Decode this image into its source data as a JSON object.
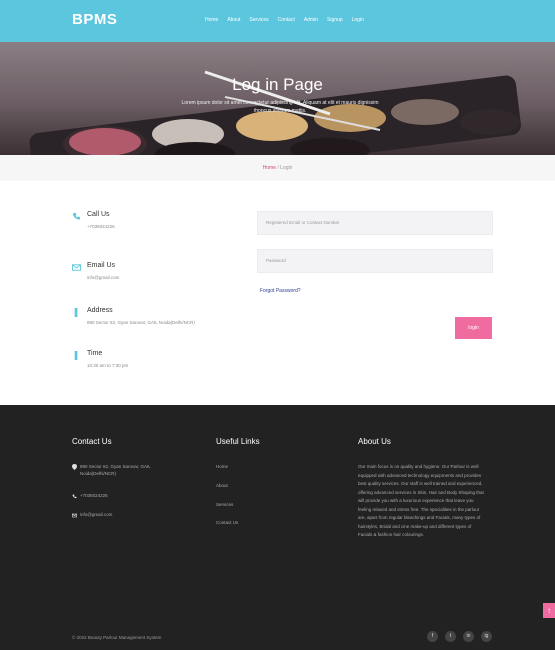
{
  "header": {
    "brand": "BPMS",
    "nav": [
      "Home",
      "About",
      "Services",
      "Contact",
      "Admin",
      "Signup",
      "Login"
    ]
  },
  "hero": {
    "title": "Log in Page",
    "subtitle": "Lorem ipsum dolor sit amet consectetur adipiscing elit. Aliquam at elit et mauris dignissim rhoncus aliquam mattis."
  },
  "breadcrumb": {
    "home": "Home",
    "separator": "/",
    "current": "Login"
  },
  "contact": {
    "call": {
      "label": "Call Us",
      "value": "+7036024226"
    },
    "email": {
      "label": "Email Us",
      "value": "info@gmail.com"
    },
    "address": {
      "label": "Address",
      "value": "890 Sector 62, Gyan Sarovar, GAIL Noida(Delhi/NCR)"
    },
    "time": {
      "label": "Time",
      "value": "10:30 am to 7:30 pm"
    }
  },
  "form": {
    "email_placeholder": "Registered Email or Contact Number",
    "password_placeholder": "Password",
    "forgot": "Forgot Password?",
    "login": "login"
  },
  "footer": {
    "contact_title": "Contact Us",
    "address": "890 Sector 62, Gyan Sarovar, GAIL Noida(Delhi/NCR)",
    "phone": "+7036024226",
    "email": "info@gmail.com",
    "links_title": "Useful Links",
    "links": [
      "Home",
      "About",
      "Services",
      "Contact Us"
    ],
    "about_title": "About Us",
    "about_text": "Our main focus is on quality and hygiene. Our Parlour is well equipped with advanced technology equipments and provides best quality services. Our staff is well trained and experienced, offering advanced services in Skin, Hair and Body Shaping that will provide you with a luxurious experience that leave you feeling relaxed and stress free. The specialities in the parlour are, apart from regular bleachings and Facials, many types of hairstyles, Bridal and cine make-up and different types of Facials & fashion hair colourings.",
    "copyright": "© 2022 Beauty Parlour Management System",
    "social": [
      "f",
      "t",
      "in",
      "ig"
    ]
  },
  "colors": {
    "header": "#5cc6df",
    "accent": "#f06ca0",
    "footer": "#222222"
  }
}
